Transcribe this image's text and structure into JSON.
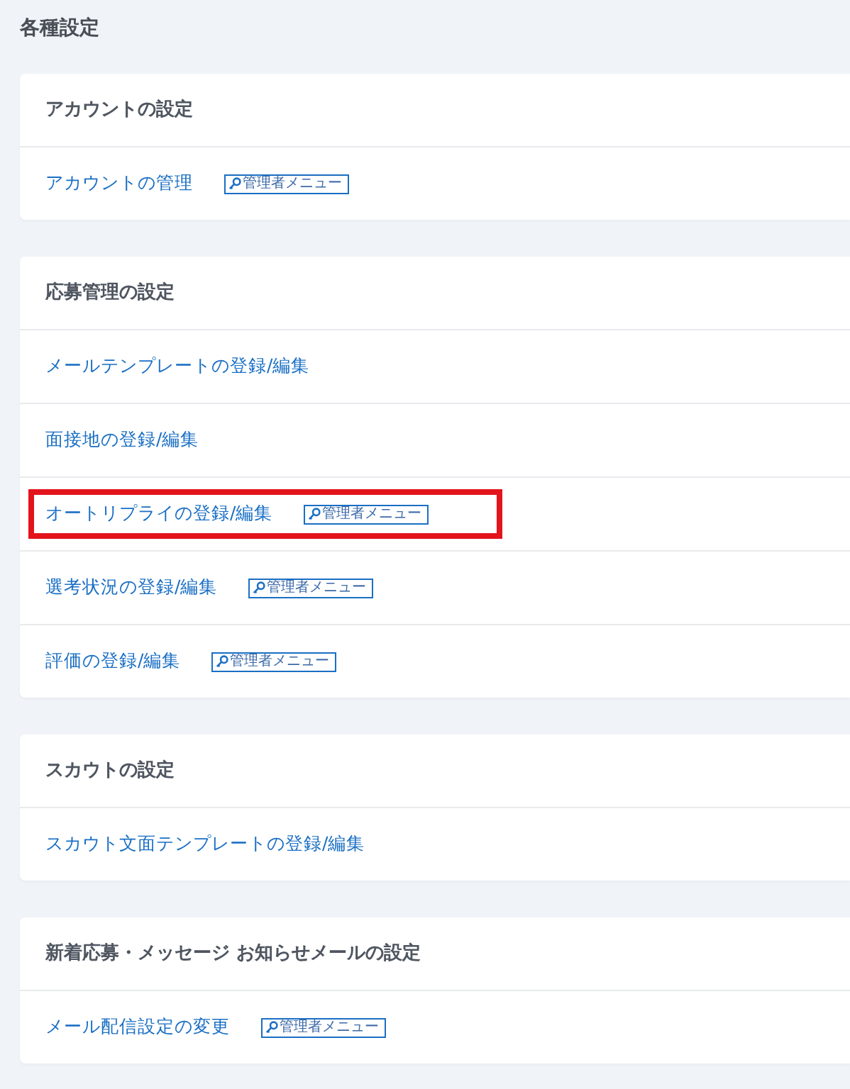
{
  "title": "各種設定",
  "sections": [
    {
      "title": "アカウントの設定",
      "items": [
        {
          "label": "アカウントの管理",
          "badge": "管理者メニュー",
          "highlighted": false
        }
      ]
    },
    {
      "title": "応募管理の設定",
      "items": [
        {
          "label": "メールテンプレートの登録/編集",
          "highlighted": false
        },
        {
          "label": "面接地の登録/編集",
          "highlighted": false
        },
        {
          "label": "オートリプライの登録/編集",
          "badge": "管理者メニュー",
          "highlighted": true
        },
        {
          "label": "選考状況の登録/編集",
          "badge": "管理者メニュー",
          "highlighted": false
        },
        {
          "label": "評価の登録/編集",
          "badge": "管理者メニュー",
          "highlighted": false
        }
      ]
    },
    {
      "title": "スカウトの設定",
      "items": [
        {
          "label": "スカウト文面テンプレートの登録/編集",
          "highlighted": false
        }
      ]
    },
    {
      "title": "新着応募・メッセージ お知らせメールの設定",
      "items": [
        {
          "label": "メール配信設定の変更",
          "badge": "管理者メニュー",
          "highlighted": false
        }
      ]
    }
  ]
}
